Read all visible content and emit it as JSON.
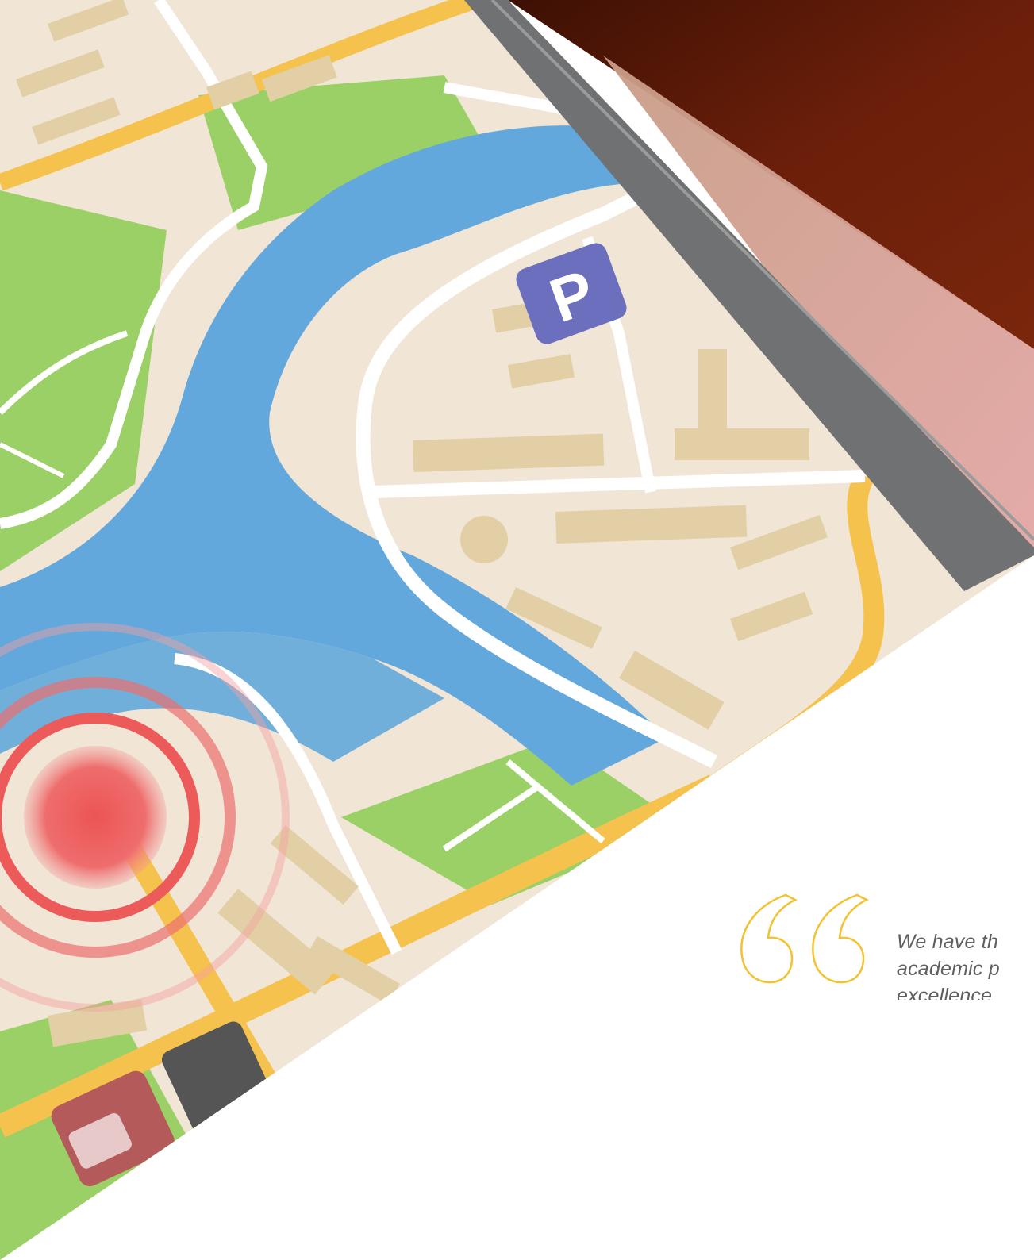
{
  "hero": {
    "image_description_icon": "map-pin-icon",
    "parking_sign_label": "P"
  },
  "testimonial": {
    "quote_icon": "quote-open-icon",
    "accent_color": "#f2c230",
    "lines": [
      "We have th",
      "academic p",
      "excellence"
    ]
  },
  "colors": {
    "water": "#63a8dc",
    "land": "#f1e5d6",
    "park": "#97cc62",
    "road": "#f6c24e",
    "bezel": "#6f7172",
    "background_dark": "#5a1a06"
  }
}
